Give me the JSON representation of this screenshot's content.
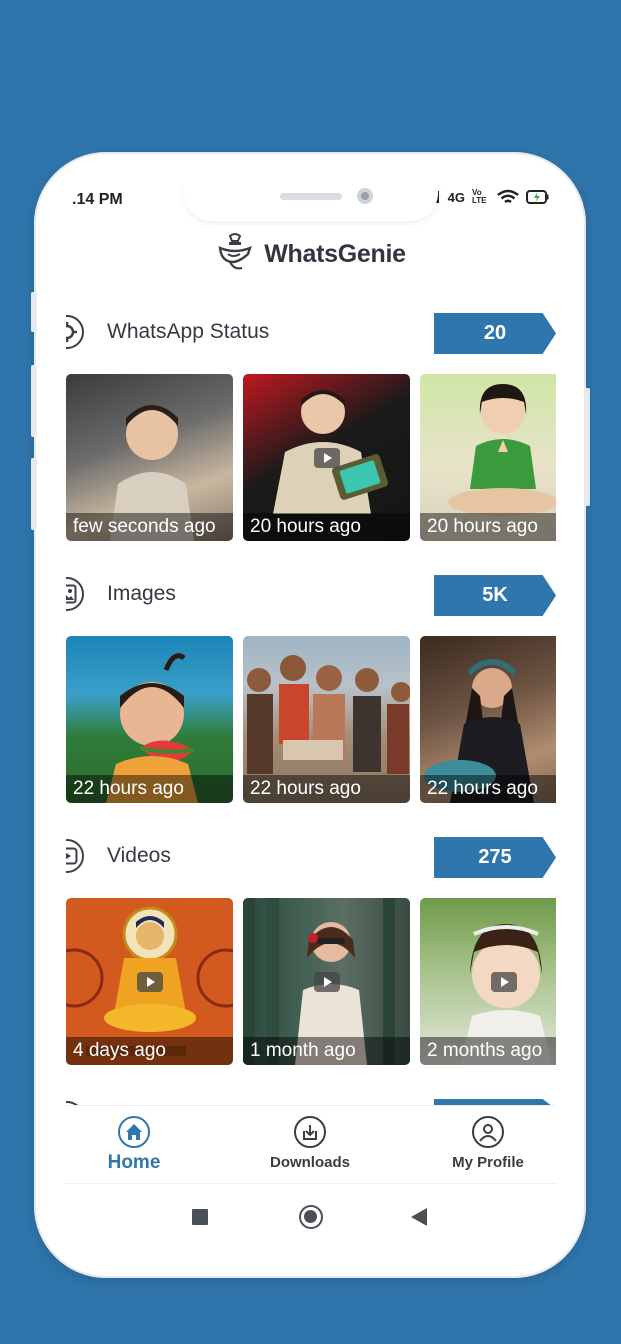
{
  "status_bar": {
    "time": ".14 PM",
    "network": "4G",
    "volte": "Vo LTE",
    "icons": [
      "signal-icon",
      "volte-icon",
      "wifi-icon",
      "battery-charging-icon"
    ]
  },
  "app": {
    "title": "WhatsGenie",
    "logo_icon": "genie-lamp-icon"
  },
  "sections": [
    {
      "title": "WhatsApp Status",
      "count": "20",
      "icon": "status-ring-icon",
      "items": [
        {
          "caption": "few seconds ago",
          "is_video": false
        },
        {
          "caption": "20 hours ago",
          "is_video": true
        },
        {
          "caption": "20 hours ago",
          "is_video": false
        }
      ]
    },
    {
      "title": "Images",
      "count": "5K",
      "icon": "image-icon",
      "items": [
        {
          "caption": "22 hours ago",
          "is_video": false
        },
        {
          "caption": "22 hours ago",
          "is_video": false
        },
        {
          "caption": "22 hours ago",
          "is_video": false
        }
      ]
    },
    {
      "title": "Videos",
      "count": "275",
      "icon": "video-play-icon",
      "items": [
        {
          "caption": "4 days ago",
          "is_video": true
        },
        {
          "caption": "1 month ago",
          "is_video": true
        },
        {
          "caption": "2 months ago",
          "is_video": true
        }
      ]
    }
  ],
  "bottom_nav": {
    "items": [
      {
        "label": "Home",
        "icon": "home-icon",
        "active": true
      },
      {
        "label": "Downloads",
        "icon": "download-icon",
        "active": false
      },
      {
        "label": "My Profile",
        "icon": "profile-icon",
        "active": false
      }
    ]
  },
  "system_nav": {
    "icons": [
      "recent-apps-icon",
      "home-circle-icon",
      "back-icon"
    ]
  },
  "colors": {
    "accent": "#2f76ad",
    "background": "#2f76ad",
    "text": "#353941"
  }
}
